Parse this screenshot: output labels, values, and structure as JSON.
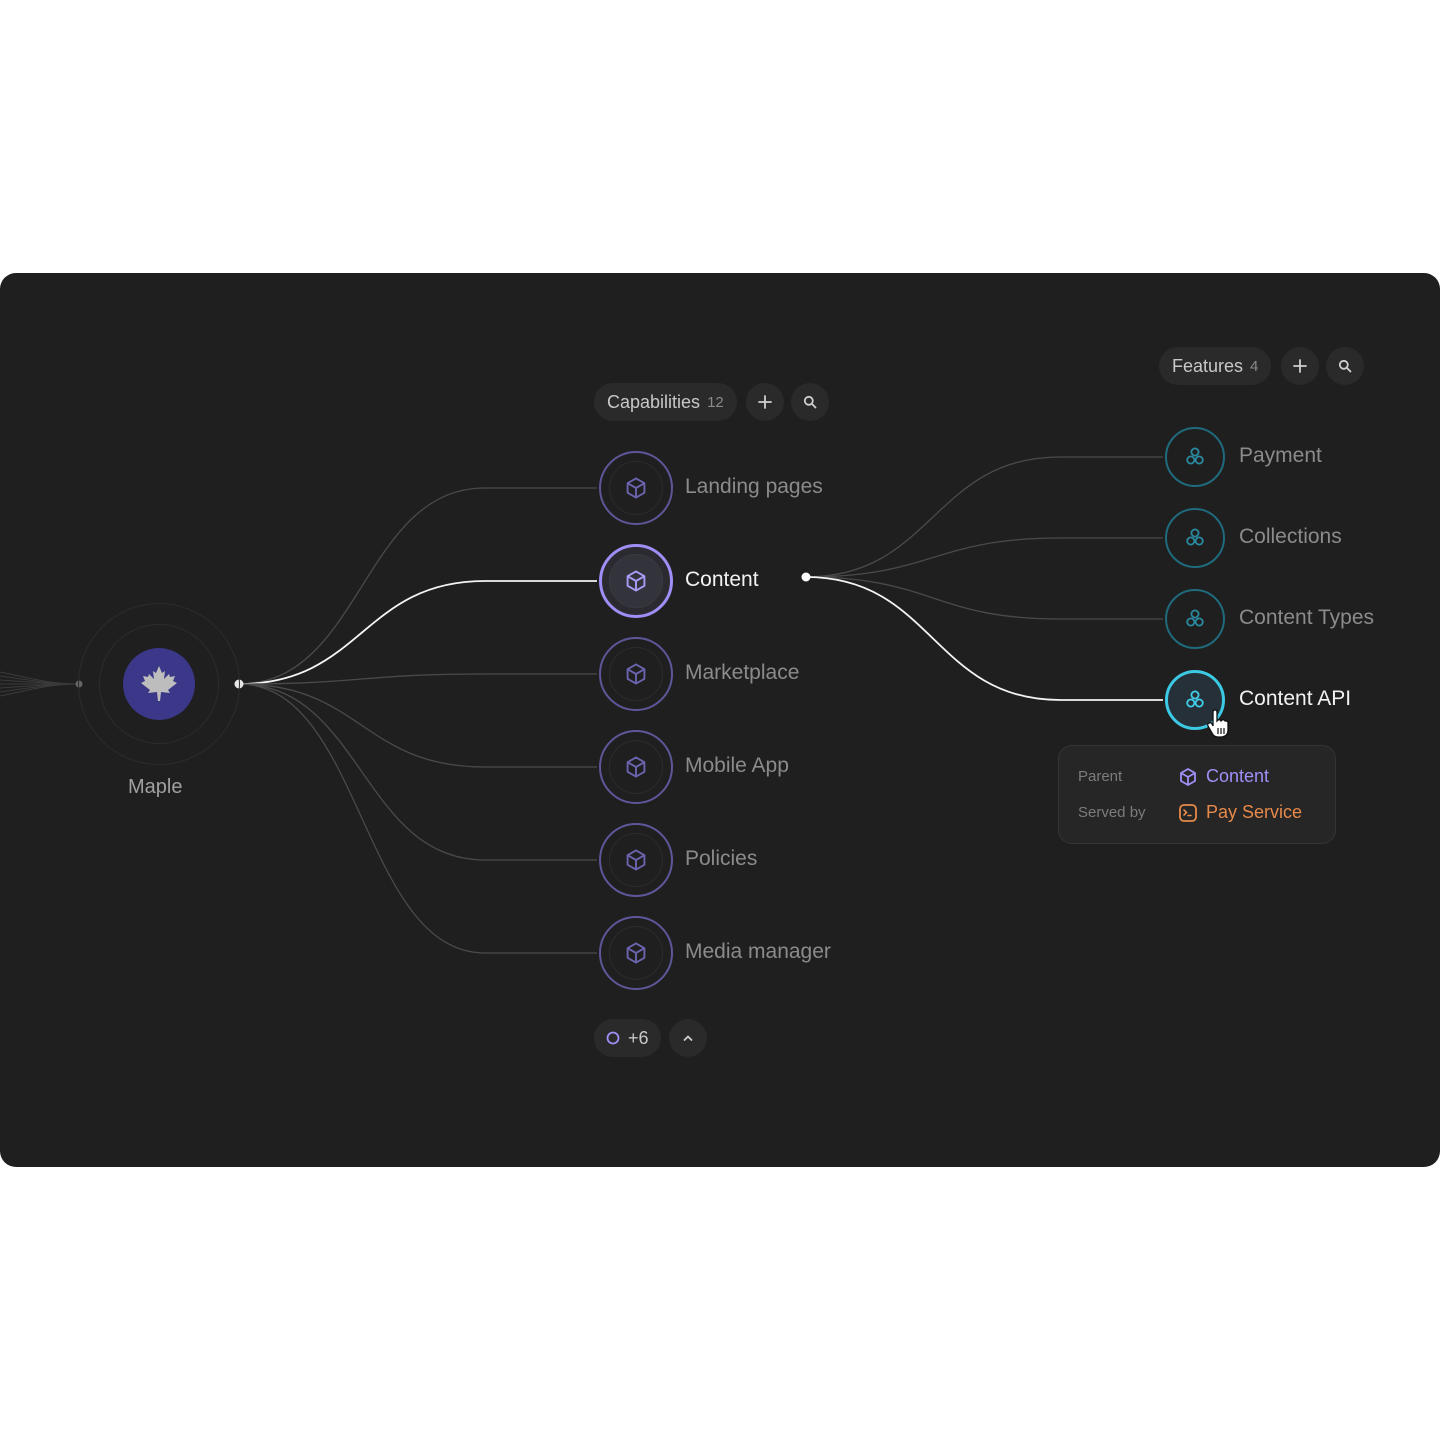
{
  "root": {
    "label": "Maple",
    "icon": "maple-leaf-icon",
    "color": "#3b3789"
  },
  "capabilities": {
    "header_label": "Capabilities",
    "count": "12",
    "add_icon": "plus-icon",
    "search_icon": "search-icon",
    "items": [
      {
        "label": "Landing pages",
        "icon": "cube-icon",
        "active": false
      },
      {
        "label": "Content",
        "icon": "cube-icon",
        "active": true
      },
      {
        "label": "Marketplace",
        "icon": "cube-icon",
        "active": false
      },
      {
        "label": "Mobile App",
        "icon": "cube-icon",
        "active": false
      },
      {
        "label": "Policies",
        "icon": "cube-icon",
        "active": false
      },
      {
        "label": "Media manager",
        "icon": "cube-icon",
        "active": false
      }
    ],
    "more_label": "+6",
    "collapse_icon": "chevron-up-icon",
    "color": "#9d8ff5"
  },
  "features": {
    "header_label": "Features",
    "count": "4",
    "add_icon": "plus-icon",
    "search_icon": "search-icon",
    "items": [
      {
        "label": "Payment",
        "icon": "circles-icon",
        "active": false
      },
      {
        "label": "Collections",
        "icon": "circles-icon",
        "active": false
      },
      {
        "label": "Content Types",
        "icon": "circles-icon",
        "active": false
      },
      {
        "label": "Content API",
        "icon": "circles-icon",
        "active": true
      }
    ],
    "color": "#3cc9e4"
  },
  "tooltip": {
    "parent_key": "Parent",
    "parent_value": "Content",
    "parent_color": "#a08ff7",
    "served_key": "Served by",
    "served_value": "Pay Service",
    "served_color": "#e8894a"
  }
}
